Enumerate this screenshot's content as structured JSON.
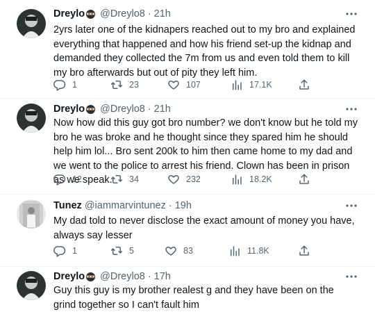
{
  "tweets": [
    {
      "name": "Dreylo",
      "handle": "@Dreylo8",
      "sep": "·",
      "time": "21h",
      "text": "2yrs later one of the kidnapers reached out to my bro and explained everything that happened and how his friend set-up the kidnap and demanded they collected the 7m from us and even told them to kill my bro afterwards but out of pity they left him.",
      "replies": "1",
      "retweets": "23",
      "likes": "107",
      "views": "17.1K"
    },
    {
      "name": "Dreylo",
      "handle": "@Dreylo8",
      "sep": "·",
      "time": "21h",
      "text": "Now how did this guy got bro number? we don't know but he told my bro he was broke and he thought since they spared him he should help him lol... Bro sent 200k to him then came home to my dad and we went to the police to arrest his friend. Clown has been in prison as we speak.",
      "replies": "12",
      "retweets": "34",
      "likes": "232",
      "views": "18.2K"
    },
    {
      "name": "Tunez",
      "handle": "@iammarvintunez",
      "sep": "·",
      "time": "19h",
      "text": "My dad told to never disclose the exact amount of money you have, always say lesser",
      "replies": "1",
      "retweets": "5",
      "likes": "83",
      "views": "11.8K"
    },
    {
      "name": "Dreylo",
      "handle": "@Dreylo8",
      "sep": "·",
      "time": "17h",
      "text": "Guy this guy is my brother realest g and they have been on the grind together so I can't fault him"
    }
  ],
  "icons": {
    "badge": "ninja-emoji-icon",
    "more": "more-options-icon",
    "reply": "reply-icon",
    "retweet": "retweet-icon",
    "like": "heart-icon",
    "views": "views-chart-icon",
    "share": "share-icon"
  },
  "colors": {
    "text": "#0f1419",
    "secondary": "#536471",
    "divider": "#eff3f4"
  }
}
